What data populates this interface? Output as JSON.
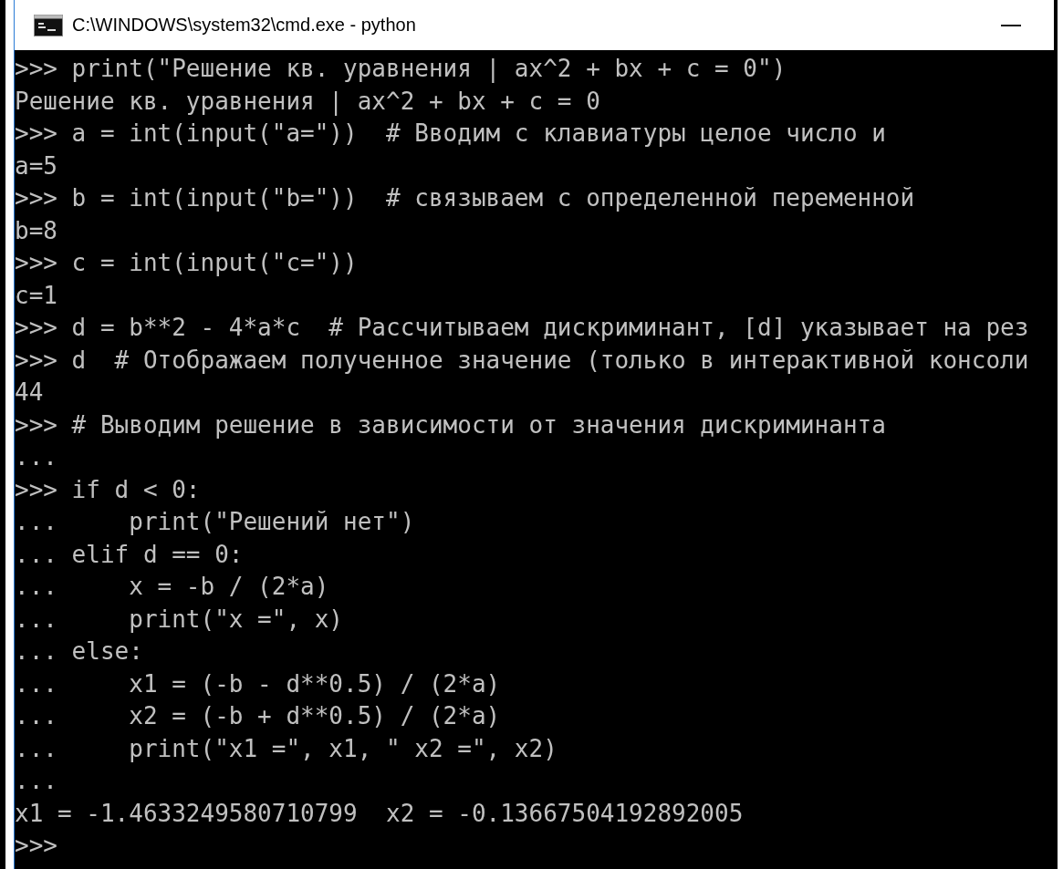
{
  "window": {
    "title": "C:\\WINDOWS\\system32\\cmd.exe - python"
  },
  "console": {
    "lines": [
      ">>> print(\"Решение кв. уравнения | ax^2 + bx + c = 0\")",
      "Решение кв. уравнения | ax^2 + bx + c = 0",
      ">>> a = int(input(\"a=\"))  # Вводим с клавиатуры целое число и",
      "a=5",
      ">>> b = int(input(\"b=\"))  # связываем с определенной переменной",
      "b=8",
      ">>> c = int(input(\"c=\"))",
      "c=1",
      ">>> d = b**2 - 4*a*c  # Рассчитываем дискриминант, [d] указывает на рез",
      ">>> d  # Отображаем полученное значение (только в интерактивной консоли",
      "44",
      ">>> # Выводим решение в зависимости от значения дискриминанта",
      "...",
      ">>> if d < 0:",
      "...     print(\"Решений нет\")",
      "... elif d == 0:",
      "...     x = -b / (2*a)",
      "...     print(\"x =\", x)",
      "... else:",
      "...     x1 = (-b - d**0.5) / (2*a)",
      "...     x2 = (-b + d**0.5) / (2*a)",
      "...     print(\"x1 =\", x1, \" x2 =\", x2)",
      "...",
      "x1 = -1.4633249580710799  x2 = -0.13667504192892005",
      ">>>"
    ]
  }
}
